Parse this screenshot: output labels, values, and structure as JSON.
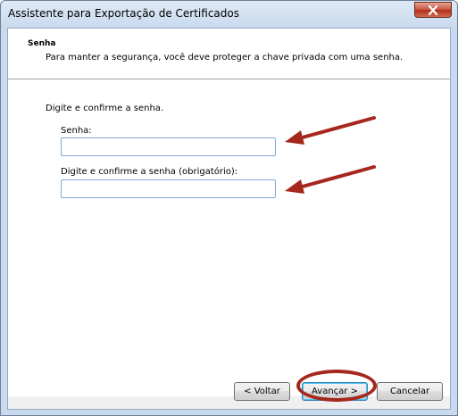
{
  "window": {
    "title": "Assistente para Exportação de Certificados",
    "close_icon": "close-icon"
  },
  "header": {
    "title": "Senha",
    "description": "Para manter a segurança, você deve proteger a chave privada com uma senha."
  },
  "body": {
    "instruction": "Digite e confirme a senha.",
    "password_label": "Senha:",
    "password_value": "",
    "confirm_label": "Digite e confirme a senha (obrigatório):",
    "confirm_value": ""
  },
  "annotations": {
    "arrow_color": "#a5271e",
    "arrow_icon": "arrow-pointer-icon",
    "highlight_color": "#a5271e"
  },
  "buttons": {
    "back": "< Voltar",
    "next": "Avançar >",
    "cancel": "Cancelar"
  }
}
